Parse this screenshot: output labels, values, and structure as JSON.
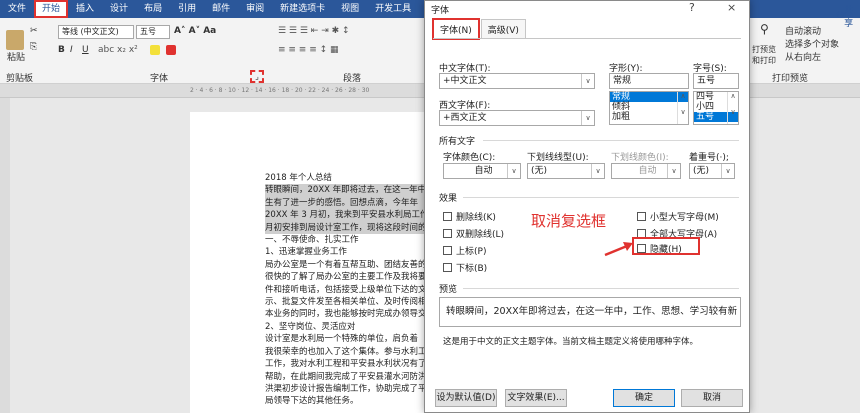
{
  "menubar": {
    "tabs": [
      "文件",
      "开始",
      "插入",
      "设计",
      "布局",
      "引用",
      "邮件",
      "审阅",
      "新建选项卡",
      "视图",
      "开发工具"
    ],
    "active_index": 1
  },
  "ribbon": {
    "paste": "粘贴",
    "clipboard": "剪贴板",
    "font_name": "等线 (中文正文)",
    "font_size": "五号",
    "font_group": "字体",
    "para_group": "段落",
    "print_preview_group": "打印预览",
    "auto_scroll": "自动滚动",
    "select_multi": "选择多个对象",
    "from_right": "从右向左",
    "preview_print": "打预览和打印",
    "share": "共享"
  },
  "document": {
    "lines": [
      "2018 年个人总结",
      "转眼瞬间，20XX 年即将过去，在这一年中",
      "生有了进一步的感悟。回想点滴，今年年 ",
      "20XX 年 3 月初，我来到平安县水利局工作",
      "月初安排到局设计室工作，现将这段时间的",
      "一、不辱使命、扎实工作",
      "1、迅速掌握业务工作",
      "局办公室是一个有着互帮互助、团结友善的",
      "很快的了解了局办公室的主要工作及我将要",
      "件和接听电话，包括接受上级单位下达的文",
      "示、批复文件发至各相关单位、及时传阅相",
      "本业务的同时，我也能够按时完成办领导交",
      "2、坚守岗位、灵活应对",
      "设计室是水利局一个特殊的单位，肩负着",
      "我很荣幸的也加入了这个集体。参与水利工",
      "工作，我对水利工程和平安县水利状况有了",
      "帮助，在此期间我完成了平安县灌水河防洪",
      "洪渠初步设计报告编制工作，协助完成了平",
      "局领导下达的其他任务。"
    ],
    "selected_lines": [
      1,
      2,
      3,
      4
    ]
  },
  "dialog": {
    "title": "字体",
    "help": "?",
    "close": "×",
    "tabs": [
      "字体(N)",
      "高级(V)"
    ],
    "cn_font_label": "中文字体(T):",
    "cn_font_value": "+中文正文",
    "west_font_label": "西文字体(F):",
    "west_font_value": "+西文正文",
    "style_label": "字形(Y):",
    "style_value": "常规",
    "style_options": [
      "常规",
      "倾斜",
      "加粗"
    ],
    "size_label": "字号(S):",
    "size_value": "五号",
    "size_options": [
      "四号",
      "小四",
      "五号"
    ],
    "all_text": "所有文字",
    "font_color_label": "字体颜色(C):",
    "font_color_value": "自动",
    "underline_label": "下划线线型(U):",
    "underline_value": "(无)",
    "underline_color_label": "下划线颜色(I):",
    "underline_color_value": "自动",
    "emphasis_label": "着重号(·);",
    "emphasis_value": "(无)",
    "effects": "效果",
    "checkboxes": {
      "strike": "删除线(K)",
      "double_strike": "双删除线(L)",
      "superscript": "上标(P)",
      "subscript": "下标(B)",
      "small_caps": "小型大写字母(M)",
      "all_caps": "全部大写字母(A)",
      "hidden": "隐藏(H)"
    },
    "annotation": "取消复选框",
    "preview_label": "预览",
    "preview_text": "转眼瞬间，20XX年即将过去，在这一年中，工作、思想、学习较有新",
    "preview_note": "这是用于中文的正文主题字体。当前文档主题定义将使用哪种字体。",
    "btn_default": "设为默认值(D)",
    "btn_effects": "文字效果(E)...",
    "btn_ok": "确定",
    "btn_cancel": "取消"
  },
  "colors": {
    "accent": "#2b579a",
    "highlight": "#e0322f",
    "selection": "#0078d7"
  }
}
